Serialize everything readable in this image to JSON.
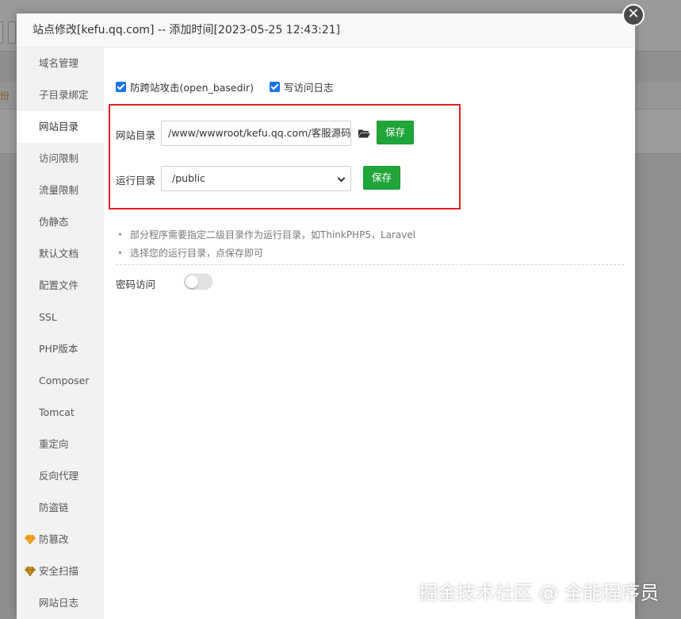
{
  "background": {
    "hint_text": "份"
  },
  "modal": {
    "title": "站点修改[kefu.qq.com] -- 添加时间[2023-05-25 12:43:21]",
    "close_glyph": "✕"
  },
  "sidebar": {
    "items": [
      {
        "label": "域名管理",
        "active": false,
        "icon": ""
      },
      {
        "label": "子目录绑定",
        "active": false,
        "icon": ""
      },
      {
        "label": "网站目录",
        "active": true,
        "icon": ""
      },
      {
        "label": "访问限制",
        "active": false,
        "icon": ""
      },
      {
        "label": "流量限制",
        "active": false,
        "icon": ""
      },
      {
        "label": "伪静态",
        "active": false,
        "icon": ""
      },
      {
        "label": "默认文档",
        "active": false,
        "icon": ""
      },
      {
        "label": "配置文件",
        "active": false,
        "icon": ""
      },
      {
        "label": "SSL",
        "active": false,
        "icon": ""
      },
      {
        "label": "PHP版本",
        "active": false,
        "icon": ""
      },
      {
        "label": "Composer",
        "active": false,
        "icon": ""
      },
      {
        "label": "Tomcat",
        "active": false,
        "icon": ""
      },
      {
        "label": "重定向",
        "active": false,
        "icon": ""
      },
      {
        "label": "反向代理",
        "active": false,
        "icon": ""
      },
      {
        "label": "防盗链",
        "active": false,
        "icon": ""
      },
      {
        "label": "防篡改",
        "active": false,
        "icon": "gem-gold-icon"
      },
      {
        "label": "安全扫描",
        "active": false,
        "icon": "gem-dark-icon"
      },
      {
        "label": "网站日志",
        "active": false,
        "icon": ""
      }
    ]
  },
  "options": {
    "open_basedir": {
      "label": "防跨站攻击(open_basedir)",
      "checked": true
    },
    "access_log": {
      "label": "写访问日志",
      "checked": true
    }
  },
  "site_dir": {
    "label": "网站目录",
    "value": "/www/wwwroot/kefu.qq.com/客服源码",
    "save_label": "保存"
  },
  "run_dir": {
    "label": "运行目录",
    "value": "/public",
    "save_label": "保存"
  },
  "tips": [
    "部分程序需要指定二级目录作为运行目录，如ThinkPHP5，Laravel",
    "选择您的运行目录，点保存即可"
  ],
  "password_access": {
    "label": "密码访问",
    "enabled": false
  },
  "watermark": "掘金技术社区 @ 全能程序员",
  "colors": {
    "accent_green": "#20a53a",
    "highlight_red": "#e02020",
    "checkbox_blue": "#1a73e8"
  }
}
